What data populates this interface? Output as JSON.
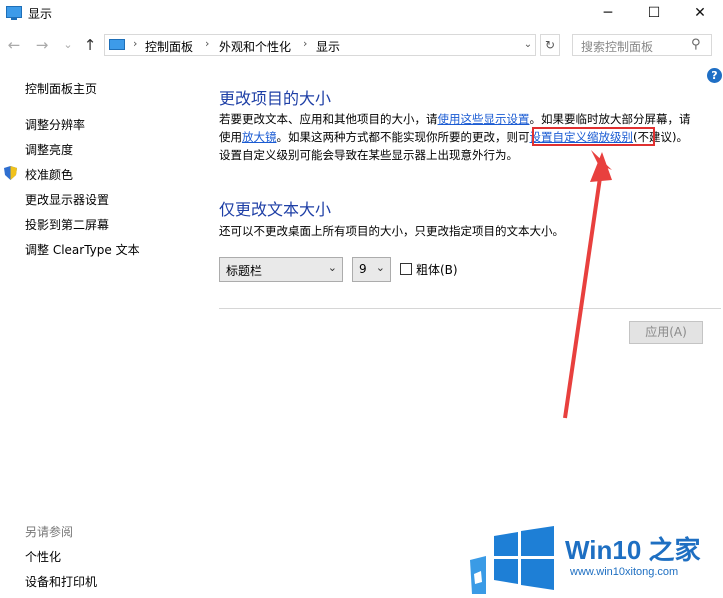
{
  "window": {
    "title": "显示",
    "minimize": "─",
    "maximize": "☐",
    "close": "✕"
  },
  "nav": {
    "back": "←",
    "forward": "→",
    "history": "⌄",
    "up": "↑",
    "breadcrumbs": [
      "控制面板",
      "外观和个性化",
      "显示"
    ],
    "separator": "›",
    "dropdown": "⌄",
    "refresh": "↻",
    "search_placeholder": "搜索控制面板",
    "search_icon": "⚲",
    "help": "?"
  },
  "sidebar": {
    "home": "控制面板主页",
    "items": [
      "调整分辨率",
      "调整亮度",
      "校准颜色",
      "更改显示器设置",
      "投影到第二屏幕",
      "调整 ClearType 文本"
    ],
    "see_also_title": "另请参阅",
    "see_also_items": [
      "个性化",
      "设备和打印机"
    ]
  },
  "main": {
    "section1_title": "更改项目的大小",
    "p1_a": "若要更改文本、应用和其他项目的大小，请",
    "p1_link": "使用这些显示设置",
    "p1_b": "。如果要临时放大部分屏幕，请",
    "p2_a": "使用",
    "p2_link1": "放大镜",
    "p2_b": "。如果这两种方式都不能实现你所要的更改，则可",
    "p2_link2": "设置自定义缩放级别",
    "p2_c": "(不建议)。",
    "p3": "设置自定义级别可能会导致在某些显示器上出现意外行为。",
    "section2_title": "仅更改文本大小",
    "p4": "还可以不更改桌面上所有项目的大小，只更改指定项目的文本大小。",
    "item_select": "标题栏",
    "size_select": "9",
    "combo_arrow": "⌄",
    "bold_label": "粗体(B)",
    "apply_label": "应用(A)"
  },
  "watermark": {
    "brand": "Win10 之家",
    "url": "www.win10xitong.com",
    "colors": {
      "blue": "#1e6fc2",
      "light": "#3a9be6"
    }
  }
}
